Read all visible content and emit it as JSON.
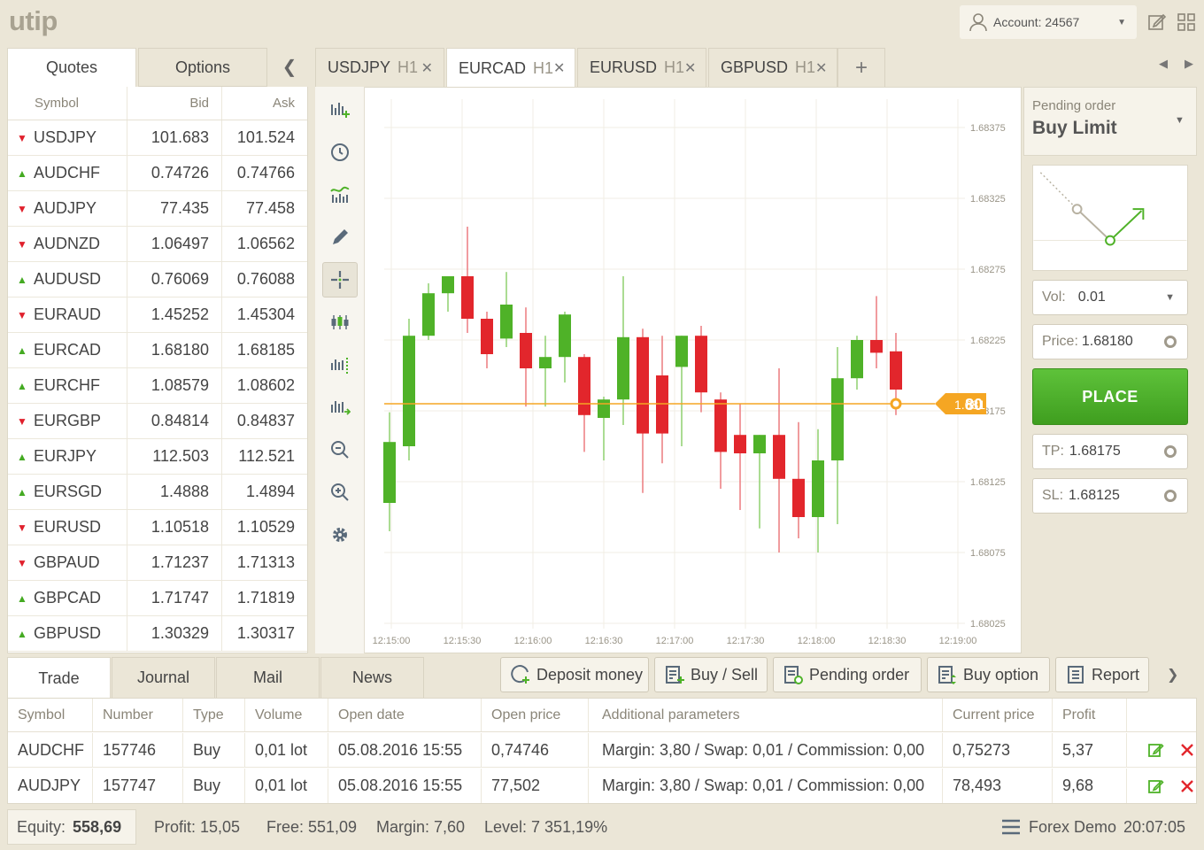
{
  "header": {
    "logo": "utip",
    "account_label": "Account: 24567"
  },
  "left_tabs": {
    "quotes": "Quotes",
    "options": "Options"
  },
  "quotes": {
    "columns": [
      "Symbol",
      "Bid",
      "Ask"
    ],
    "rows": [
      {
        "symbol": "USDJPY",
        "dir": "down",
        "bid": "101.683",
        "ask": "101.524"
      },
      {
        "symbol": "AUDCHF",
        "dir": "up",
        "bid": "0.74726",
        "ask": "0.74766"
      },
      {
        "symbol": "AUDJPY",
        "dir": "down",
        "bid": "77.435",
        "ask": "77.458"
      },
      {
        "symbol": "AUDNZD",
        "dir": "down",
        "bid": "1.06497",
        "ask": "1.06562"
      },
      {
        "symbol": "AUDUSD",
        "dir": "up",
        "bid": "0.76069",
        "ask": "0.76088"
      },
      {
        "symbol": "EURAUD",
        "dir": "down",
        "bid": "1.45252",
        "ask": "1.45304"
      },
      {
        "symbol": "EURCAD",
        "dir": "up",
        "bid": "1.68180",
        "ask": "1.68185"
      },
      {
        "symbol": "EURCHF",
        "dir": "up",
        "bid": "1.08579",
        "ask": "1.08602"
      },
      {
        "symbol": "EURGBP",
        "dir": "down",
        "bid": "0.84814",
        "ask": "0.84837"
      },
      {
        "symbol": "EURJPY",
        "dir": "up",
        "bid": "112.503",
        "ask": "112.521"
      },
      {
        "symbol": "EURSGD",
        "dir": "up",
        "bid": "1.4888",
        "ask": "1.4894"
      },
      {
        "symbol": "EURUSD",
        "dir": "down",
        "bid": "1.10518",
        "ask": "1.10529"
      },
      {
        "symbol": "GBPAUD",
        "dir": "down",
        "bid": "1.71237",
        "ask": "1.71313"
      },
      {
        "symbol": "GBPCAD",
        "dir": "up",
        "bid": "1.71747",
        "ask": "1.71819"
      },
      {
        "symbol": "GBPUSD",
        "dir": "up",
        "bid": "1.30329",
        "ask": "1.30317"
      }
    ]
  },
  "chart_tabs": [
    {
      "symbol": "USDJPY",
      "tf": "H1",
      "active": false
    },
    {
      "symbol": "EURCAD",
      "tf": "H1",
      "active": true
    },
    {
      "symbol": "EURUSD",
      "tf": "H1",
      "active": false
    },
    {
      "symbol": "GBPUSD",
      "tf": "H1",
      "active": false
    }
  ],
  "chart_tab_add": "+",
  "chart_data": {
    "type": "candlestick",
    "x_ticks": [
      "12:15:00",
      "12:15:30",
      "12:16:00",
      "12:16:30",
      "12:17:00",
      "12:17:30",
      "12:18:00",
      "12:18:30",
      "12:19:00"
    ],
    "y_ticks": [
      "1.68375",
      "1.68325",
      "1.68275",
      "1.68225",
      "1.68175",
      "1.68125",
      "1.68075",
      "1.68025"
    ],
    "ylim": [
      1.68025,
      1.68375
    ],
    "current_price": 1.6818,
    "current_price_label_main": "1.681",
    "current_price_label_big": "80",
    "colors": {
      "up": "#4fb228",
      "down": "#e2262c",
      "price_line": "#f5a623"
    },
    "candles": [
      {
        "o": 1.6811,
        "h": 1.68174,
        "l": 1.6809,
        "c": 1.68153
      },
      {
        "o": 1.6815,
        "h": 1.6824,
        "l": 1.6814,
        "c": 1.68228
      },
      {
        "o": 1.68228,
        "h": 1.68265,
        "l": 1.68225,
        "c": 1.68258
      },
      {
        "o": 1.68258,
        "h": 1.68262,
        "l": 1.68245,
        "c": 1.6827
      },
      {
        "o": 1.6827,
        "h": 1.68305,
        "l": 1.6823,
        "c": 1.6824
      },
      {
        "o": 1.6824,
        "h": 1.68245,
        "l": 1.68205,
        "c": 1.68215
      },
      {
        "o": 1.68226,
        "h": 1.68273,
        "l": 1.6822,
        "c": 1.6825
      },
      {
        "o": 1.6823,
        "h": 1.68248,
        "l": 1.68178,
        "c": 1.68205
      },
      {
        "o": 1.68205,
        "h": 1.68228,
        "l": 1.68178,
        "c": 1.68213
      },
      {
        "o": 1.68213,
        "h": 1.68245,
        "l": 1.68195,
        "c": 1.68243
      },
      {
        "o": 1.68213,
        "h": 1.68215,
        "l": 1.68146,
        "c": 1.68172
      },
      {
        "o": 1.6817,
        "h": 1.68185,
        "l": 1.6814,
        "c": 1.68183
      },
      {
        "o": 1.68183,
        "h": 1.6827,
        "l": 1.68165,
        "c": 1.68227
      },
      {
        "o": 1.68227,
        "h": 1.68233,
        "l": 1.68117,
        "c": 1.68159
      },
      {
        "o": 1.682,
        "h": 1.68228,
        "l": 1.68138,
        "c": 1.68159
      },
      {
        "o": 1.68206,
        "h": 1.68216,
        "l": 1.6815,
        "c": 1.68228
      },
      {
        "o": 1.68228,
        "h": 1.68235,
        "l": 1.68174,
        "c": 1.68188
      },
      {
        "o": 1.68183,
        "h": 1.68188,
        "l": 1.6812,
        "c": 1.68146
      },
      {
        "o": 1.68158,
        "h": 1.6818,
        "l": 1.68105,
        "c": 1.68145
      },
      {
        "o": 1.68145,
        "h": 1.68155,
        "l": 1.68092,
        "c": 1.68158
      },
      {
        "o": 1.68158,
        "h": 1.68205,
        "l": 1.68075,
        "c": 1.68127
      },
      {
        "o": 1.68127,
        "h": 1.68167,
        "l": 1.68085,
        "c": 1.681
      },
      {
        "o": 1.681,
        "h": 1.68162,
        "l": 1.68075,
        "c": 1.6814
      },
      {
        "o": 1.6814,
        "h": 1.6822,
        "l": 1.68095,
        "c": 1.68198
      },
      {
        "o": 1.68198,
        "h": 1.68228,
        "l": 1.6819,
        "c": 1.68225
      },
      {
        "o": 1.68225,
        "h": 1.68256,
        "l": 1.68205,
        "c": 1.68216
      },
      {
        "o": 1.68217,
        "h": 1.6823,
        "l": 1.68172,
        "c": 1.6819
      }
    ]
  },
  "order": {
    "pending_label": "Pending order",
    "pending_type": "Buy Limit",
    "vol_label": "Vol:",
    "vol_value": "0.01",
    "price_label": "Price:",
    "price_value": "1.68180",
    "place_label": "PLACE",
    "tp_label": "TP:",
    "tp_value": "1.68175",
    "sl_label": "SL:",
    "sl_value": "1.68125"
  },
  "bottom_tabs": [
    "Trade",
    "Journal",
    "Mail",
    "News"
  ],
  "actions": {
    "deposit": "Deposit money",
    "buysell": "Buy / Sell",
    "pending": "Pending order",
    "option": "Buy option",
    "report": "Report"
  },
  "trades": {
    "columns": [
      "Symbol",
      "Number",
      "Type",
      "Volume",
      "Open date",
      "Open price",
      "Additional parameters",
      "Current price",
      "Profit"
    ],
    "rows": [
      [
        "AUDCHF",
        "157746",
        "Buy",
        "0,01 lot",
        "05.08.2016 15:55",
        "0,74746",
        "Margin: 3,80 / Swap: 0,01 / Commission: 0,00",
        "0,75273",
        "5,37"
      ],
      [
        "AUDJPY",
        "157747",
        "Buy",
        "0,01 lot",
        "05.08.2016 15:55",
        "77,502",
        "Margin: 3,80 / Swap: 0,01 / Commission: 0,00",
        "78,493",
        "9,68"
      ]
    ]
  },
  "status": {
    "equity_label": "Equity:",
    "equity_value": "558,69",
    "profit": "Profit: 15,05",
    "free": "Free: 551,09",
    "margin": "Margin: 7,60",
    "level": "Level: 7 351,19%",
    "account_name": "Forex Demo",
    "time": "20:07:05"
  }
}
